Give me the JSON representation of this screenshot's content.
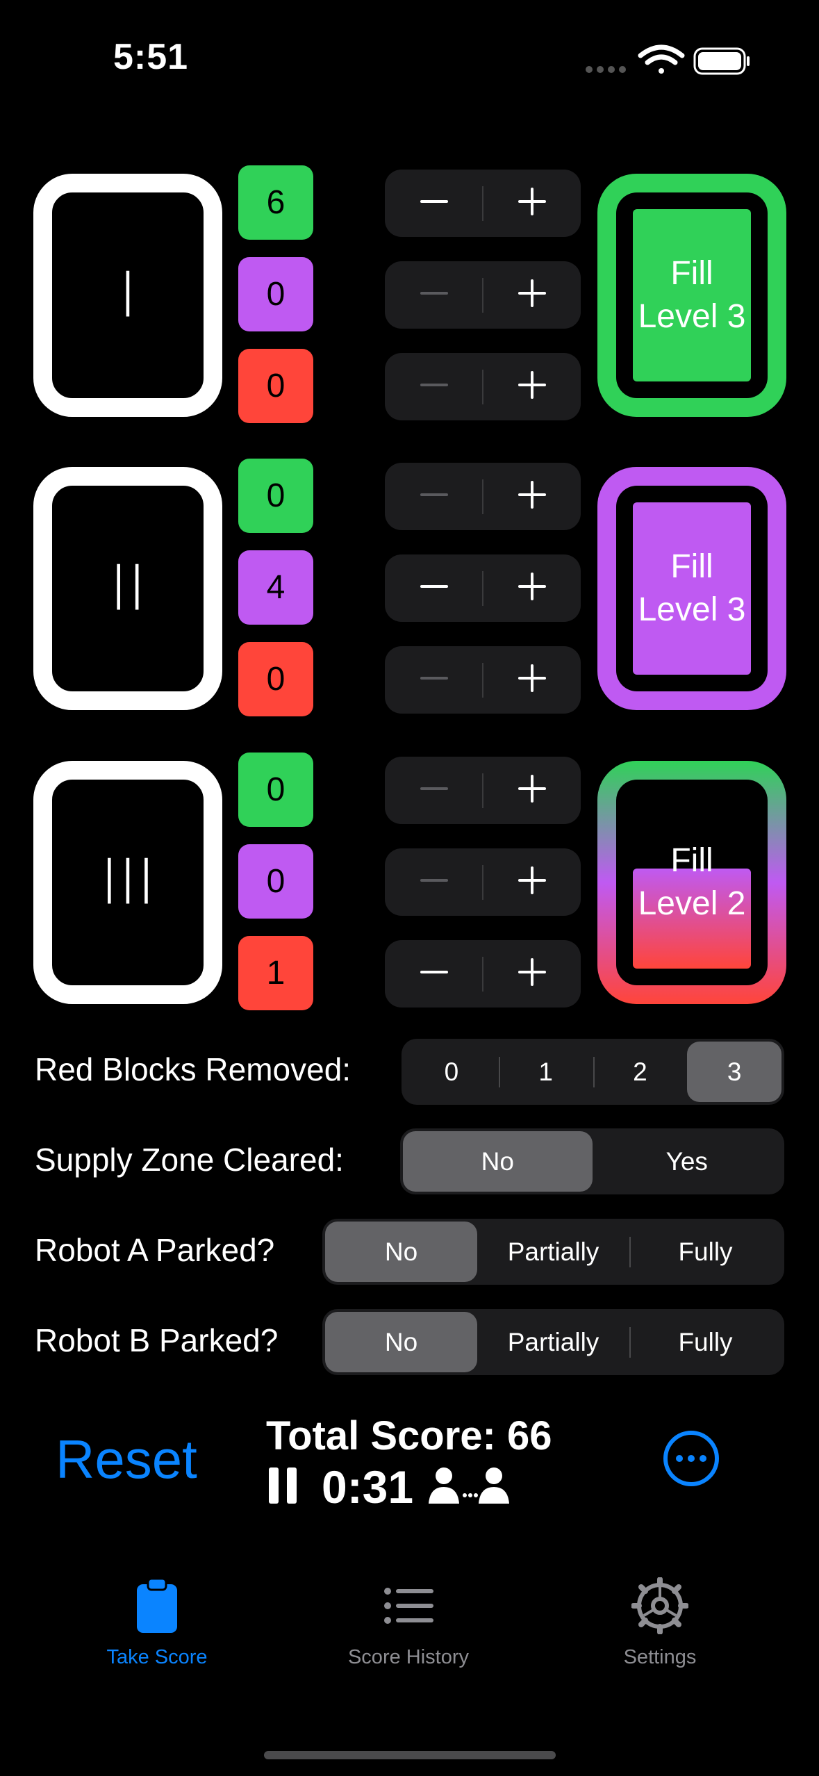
{
  "status_bar": {
    "time": "5:51"
  },
  "goals": [
    {
      "label": "I",
      "counts": [
        "6",
        "0",
        "0"
      ],
      "fill_label": "Fill\nLevel 3",
      "fill_line1": "Fill",
      "fill_line2": "Level 3",
      "fill_color": "#30d158"
    },
    {
      "label": "II",
      "counts": [
        "0",
        "4",
        "0"
      ],
      "fill_label": "Fill\nLevel 3",
      "fill_line1": "Fill",
      "fill_line2": "Level 3",
      "fill_color": "#bf5af2"
    },
    {
      "label": "III",
      "counts": [
        "0",
        "0",
        "1"
      ],
      "fill_label": "Fill\nLevel 2",
      "fill_line1": "Fill",
      "fill_line2": "Level 2",
      "fill_color": "gradient"
    }
  ],
  "colors": {
    "green": "#30d158",
    "purple": "#bf5af2",
    "red": "#ff453a",
    "accent": "#0a84ff"
  },
  "red_blocks": {
    "label": "Red Blocks Removed:",
    "options": [
      "0",
      "1",
      "2",
      "3"
    ],
    "selected": "3"
  },
  "supply_zone": {
    "label": "Supply Zone Cleared:",
    "options": [
      "No",
      "Yes"
    ],
    "selected": "No"
  },
  "robot_a": {
    "label": "Robot A Parked?",
    "options": [
      "No",
      "Partially",
      "Fully"
    ],
    "selected": "No"
  },
  "robot_b": {
    "label": "Robot B Parked?",
    "options": [
      "No",
      "Partially",
      "Fully"
    ],
    "selected": "No"
  },
  "bottom": {
    "reset_label": "Reset",
    "total_score": "Total Score: 66",
    "timer": "0:31"
  },
  "tabs": [
    {
      "label": "Take Score",
      "icon": "clipboard-icon",
      "active": true
    },
    {
      "label": "Score History",
      "icon": "list-icon",
      "active": false
    },
    {
      "label": "Settings",
      "icon": "gear-icon",
      "active": false
    }
  ]
}
